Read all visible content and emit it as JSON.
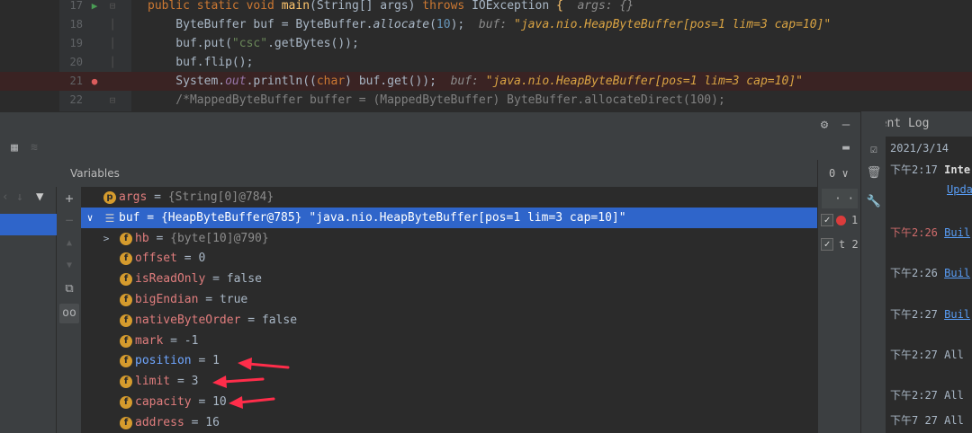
{
  "editor": {
    "lines": [
      {
        "no": "17",
        "tokens": [
          [
            "kw",
            "public static void "
          ],
          [
            "fn",
            "main"
          ],
          [
            "",
            "(String[] args) "
          ],
          [
            "kw",
            "throws "
          ],
          [
            "",
            "IOException "
          ],
          [
            "fn",
            "{"
          ],
          [
            "hint",
            "  args: {}"
          ]
        ]
      },
      {
        "no": "18",
        "tokens": [
          [
            "",
            "    ByteBuffer buf = ByteBuffer."
          ],
          [
            "it",
            "allocate"
          ],
          [
            "",
            "("
          ],
          [
            "nm",
            "10"
          ],
          [
            "",
            "); "
          ],
          [
            "hint",
            " buf: "
          ],
          [
            "hintv",
            "\"java.nio.HeapByteBuffer[pos=1 lim=3 cap=10]\""
          ]
        ]
      },
      {
        "no": "19",
        "tokens": [
          [
            "",
            "    buf.put("
          ],
          [
            "st",
            "\"csc\""
          ],
          [
            "",
            ".getBytes());"
          ]
        ]
      },
      {
        "no": "20",
        "tokens": [
          [
            "",
            "    buf.flip();"
          ]
        ]
      },
      {
        "no": "21",
        "tokens": [
          [
            "",
            "    System."
          ],
          [
            "field",
            "out"
          ],
          [
            "",
            ".println(("
          ],
          [
            "kw",
            "char"
          ],
          [
            "",
            ") buf.get());  "
          ],
          [
            "hint",
            "buf: "
          ],
          [
            "hintv",
            "\"java.nio.HeapByteBuffer[pos=1 lim=3 cap=10]\""
          ]
        ]
      },
      {
        "no": "22",
        "tokens": [
          [
            "cm",
            "    /*MappedByteBuffer buffer = (MappedByteBuffer) ByteBuffer.allocateDirect(100);"
          ]
        ]
      }
    ]
  },
  "debug": {
    "variables_title": "Variables",
    "watches_header": "0 ∨",
    "watches_dots": "· ·",
    "watches": [
      {
        "checked": true,
        "dot": true,
        "label": "1"
      },
      {
        "checked": true,
        "dot": false,
        "label": "t 2"
      }
    ]
  },
  "variables": [
    {
      "indent": 0,
      "arrow": "",
      "badge": "p",
      "name": "args",
      "op": " = ",
      "type": "{String[0]@784}",
      "value": "",
      "selected": false,
      "changed": false
    },
    {
      "indent": 0,
      "arrow": "∨",
      "badge": "list",
      "name": "buf",
      "op": " = ",
      "type": "{HeapByteBuffer@785} ",
      "value": "\"java.nio.HeapByteBuffer[pos=1 lim=3 cap=10]\"",
      "selected": true,
      "changed": false
    },
    {
      "indent": 1,
      "arrow": ">",
      "badge": "f",
      "name": "hb",
      "op": " = ",
      "type": "{byte[10]@790}",
      "value": "",
      "selected": false,
      "changed": false
    },
    {
      "indent": 1,
      "arrow": "",
      "badge": "f",
      "name": "offset",
      "op": " = ",
      "type": "",
      "value": "0",
      "selected": false,
      "changed": false
    },
    {
      "indent": 1,
      "arrow": "",
      "badge": "f",
      "name": "isReadOnly",
      "op": " = ",
      "type": "",
      "value": "false",
      "selected": false,
      "changed": false
    },
    {
      "indent": 1,
      "arrow": "",
      "badge": "f",
      "name": "bigEndian",
      "op": " = ",
      "type": "",
      "value": "true",
      "selected": false,
      "changed": false
    },
    {
      "indent": 1,
      "arrow": "",
      "badge": "f",
      "name": "nativeByteOrder",
      "op": " = ",
      "type": "",
      "value": "false",
      "selected": false,
      "changed": false
    },
    {
      "indent": 1,
      "arrow": "",
      "badge": "f",
      "name": "mark",
      "op": " = ",
      "type": "",
      "value": "-1",
      "selected": false,
      "changed": false
    },
    {
      "indent": 1,
      "arrow": "",
      "badge": "f",
      "name": "position",
      "op": " = ",
      "type": "",
      "value": "1",
      "selected": false,
      "changed": true
    },
    {
      "indent": 1,
      "arrow": "",
      "badge": "f",
      "name": "limit",
      "op": " = ",
      "type": "",
      "value": "3",
      "selected": false,
      "changed": false
    },
    {
      "indent": 1,
      "arrow": "",
      "badge": "f",
      "name": "capacity",
      "op": " = ",
      "type": "",
      "value": "10",
      "selected": false,
      "changed": false
    },
    {
      "indent": 1,
      "arrow": "",
      "badge": "f",
      "name": "address",
      "op": " = ",
      "type": "",
      "value": "16",
      "selected": false,
      "changed": false
    }
  ],
  "event_log": {
    "title": "Event Log",
    "date": "2021/3/14",
    "entries": [
      {
        "time": "下午2:17",
        "red": false,
        "text": "Inte",
        "bold": true,
        "link": ""
      },
      {
        "time": "",
        "red": false,
        "text": "",
        "bold": false,
        "link": "Upda"
      },
      {
        "time": "下午2:26",
        "red": true,
        "text": "",
        "bold": false,
        "link": "Buil"
      },
      {
        "time": "下午2:26",
        "red": false,
        "text": "",
        "bold": false,
        "link": "Buil"
      },
      {
        "time": "下午2:27",
        "red": false,
        "text": "",
        "bold": false,
        "link": "Buil"
      },
      {
        "time": "下午2:27",
        "red": false,
        "text": "All",
        "bold": false,
        "link": ""
      },
      {
        "time": "下午2:27",
        "red": false,
        "text": "All",
        "bold": false,
        "link": ""
      },
      {
        "time": "下午7",
        "red": false,
        "text": " 27 All",
        "bold": false,
        "link": ""
      }
    ]
  },
  "colors": {
    "selection": "#2f65ca",
    "field_badge": "#d59b2d",
    "annotation_arrows": "#ff2d4a"
  }
}
